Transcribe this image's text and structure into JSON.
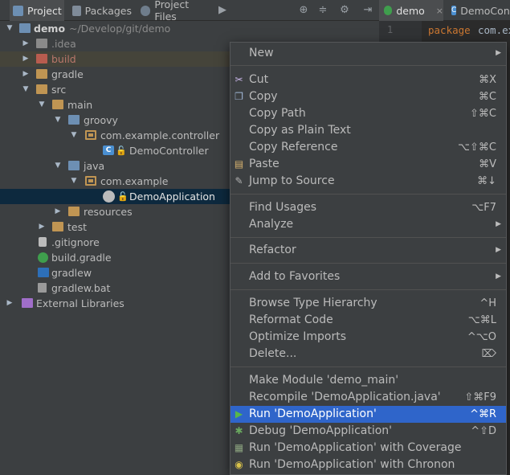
{
  "toolbar": {
    "tabs": [
      {
        "label": "Project",
        "active": true
      },
      {
        "label": "Packages",
        "active": false
      },
      {
        "label": "Project Files",
        "active": false
      }
    ],
    "more_label": "▶"
  },
  "editor": {
    "tabs": [
      {
        "label": "demo"
      },
      {
        "label": "DemoConti"
      }
    ],
    "line_number": "1",
    "keyword": "package",
    "code_text": "com.exa"
  },
  "tree": {
    "root_label": "demo",
    "root_path": "~/Develop/git/demo",
    "items": [
      {
        "label": ".idea"
      },
      {
        "label": "build"
      },
      {
        "label": "gradle"
      },
      {
        "label": "src"
      },
      {
        "label": "main"
      },
      {
        "label": "groovy"
      },
      {
        "label": "com.example.controller"
      },
      {
        "label": "DemoController"
      },
      {
        "label": "java"
      },
      {
        "label": "com.example"
      },
      {
        "label": "DemoApplication"
      },
      {
        "label": "resources"
      },
      {
        "label": "test"
      },
      {
        "label": ".gitignore"
      },
      {
        "label": "build.gradle"
      },
      {
        "label": "gradlew"
      },
      {
        "label": "gradlew.bat"
      },
      {
        "label": "External Libraries"
      }
    ]
  },
  "menu": {
    "items": [
      {
        "label": "New",
        "shortcut": ""
      },
      {
        "label": "Cut",
        "shortcut": "⌘X"
      },
      {
        "label": "Copy",
        "shortcut": "⌘C"
      },
      {
        "label": "Copy Path",
        "shortcut": "⇧⌘C"
      },
      {
        "label": "Copy as Plain Text",
        "shortcut": ""
      },
      {
        "label": "Copy Reference",
        "shortcut": "⌥⇧⌘C"
      },
      {
        "label": "Paste",
        "shortcut": "⌘V"
      },
      {
        "label": "Jump to Source",
        "shortcut": "⌘↓"
      },
      {
        "label": "Find Usages",
        "shortcut": "⌥F7"
      },
      {
        "label": "Analyze",
        "shortcut": ""
      },
      {
        "label": "Refactor",
        "shortcut": ""
      },
      {
        "label": "Add to Favorites",
        "shortcut": ""
      },
      {
        "label": "Browse Type Hierarchy",
        "shortcut": "^H"
      },
      {
        "label": "Reformat Code",
        "shortcut": "⌥⌘L"
      },
      {
        "label": "Optimize Imports",
        "shortcut": "^⌥O"
      },
      {
        "label": "Delete...",
        "shortcut": "⌦"
      },
      {
        "label": "Make Module 'demo_main'",
        "shortcut": ""
      },
      {
        "label": "Recompile 'DemoApplication.java'",
        "shortcut": "⇧⌘F9"
      },
      {
        "label": "Run 'DemoApplication'",
        "shortcut": "^⌘R"
      },
      {
        "label": "Debug 'DemoApplication'",
        "shortcut": "^⇧D"
      },
      {
        "label": "Run 'DemoApplication' with Coverage",
        "shortcut": ""
      },
      {
        "label": "Run 'DemoApplication' with Chronon",
        "shortcut": ""
      }
    ]
  },
  "colors": {
    "background": "#3c3f41",
    "selection": "#2f65ca",
    "tree_selection": "#0d293e"
  }
}
